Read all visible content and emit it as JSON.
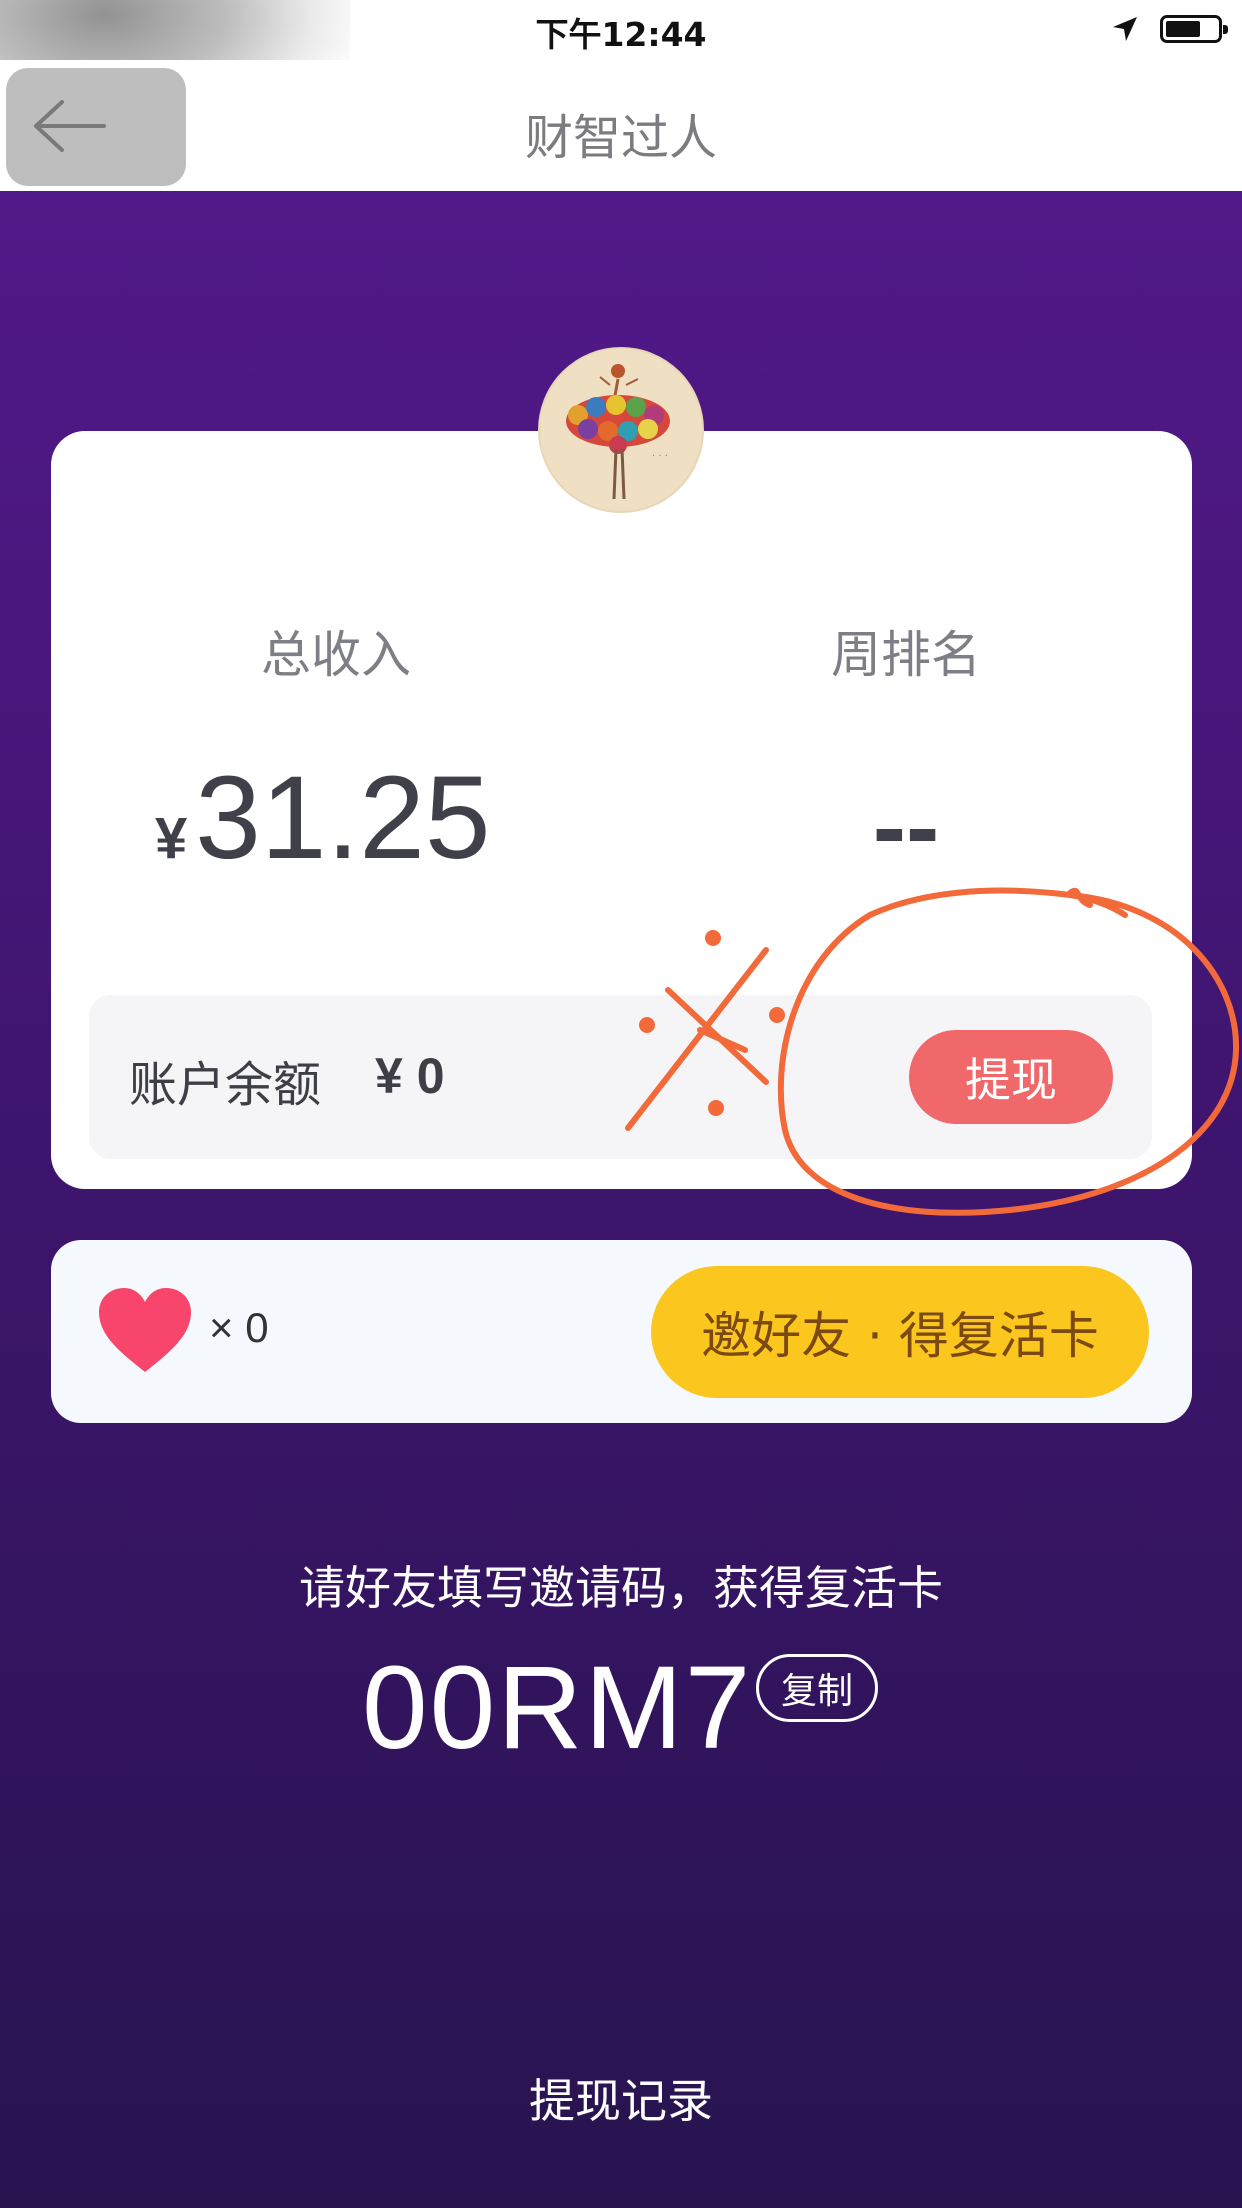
{
  "status_bar": {
    "time": "下午12:44",
    "icons": [
      "location-arrow-icon",
      "battery-icon"
    ]
  },
  "nav": {
    "title": "财智过人",
    "back_icon": "back-arrow-icon"
  },
  "stats": {
    "total_income_label": "总收入",
    "total_income_currency": "¥",
    "total_income_value": "31.25",
    "weekly_rank_label": "周排名",
    "weekly_rank_value": "--"
  },
  "balance": {
    "label": "账户余额",
    "value": "¥ 0",
    "withdraw_label": "提现"
  },
  "lives": {
    "icon": "heart-icon",
    "count": "× 0",
    "invite_button_label": "邀好友 · 得复活卡"
  },
  "invite": {
    "hint": "请好友填写邀请码，获得复活卡",
    "code": "00RM7",
    "copy_label": "复制"
  },
  "records_link": "提现记录",
  "colors": {
    "purple_top": "#52198a",
    "purple_bottom": "#27144f",
    "withdraw_button": "#f0686a",
    "invite_button": "#fbc61d",
    "heart": "#f7456b",
    "annotation": "#f26a3a"
  }
}
